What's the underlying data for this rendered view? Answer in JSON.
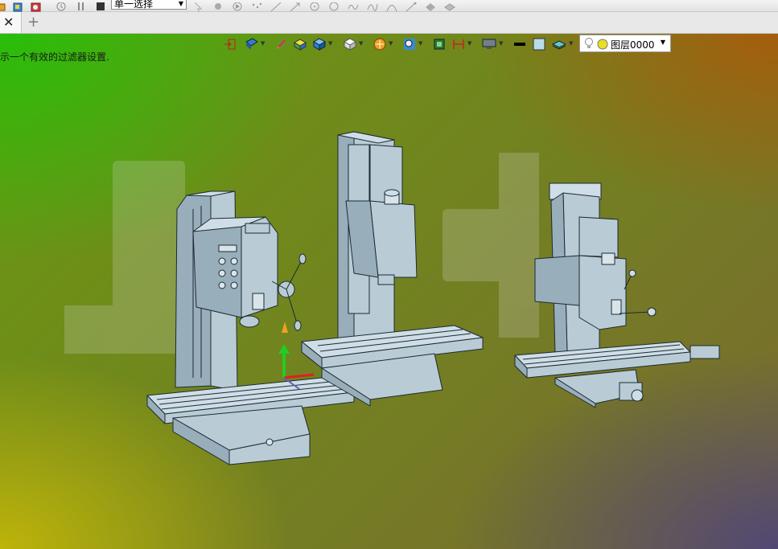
{
  "toolbar": {
    "selection_mode": "单一选择"
  },
  "tabs": {
    "close_symbol": "✕",
    "add_symbol": "+"
  },
  "viewport": {
    "message": "示一个有效的过滤器设置.",
    "layer_select": {
      "value": "图层0000"
    }
  },
  "icons": {
    "top_toolbar": [
      "part-icon",
      "assembly-icon",
      "drawing-icon",
      "history-icon",
      "pause-icon",
      "stop-icon",
      "arrow-select-icon",
      "gear-select-icon",
      "play-icon",
      "points-icon",
      "line-icon",
      "arrow-line-icon",
      "circle-icon",
      "rotate-icon",
      "spline-icon",
      "curve-icon",
      "sketch-icon",
      "vertex-icon",
      "feature-icon",
      "surface-icon"
    ],
    "view_toolbar": [
      "exit-icon",
      "render-mode-icon",
      "brush-icon",
      "box-solid-icon",
      "cube-icon",
      "view-cube-icon",
      "filter-icon",
      "zoom-icon",
      "frame-icon",
      "dimension-icon",
      "display-icon",
      "line-color-icon",
      "fill-color-icon",
      "layer-stack-icon",
      "bulb-icon",
      "layer-color-icon"
    ]
  },
  "colors": {
    "machine_fill": "#b9ccd6",
    "machine_dark": "#98aebb",
    "machine_stroke": "#1d2a33",
    "axis_green": "#22cc22",
    "axis_red": "#e02020",
    "axis_orange": "#f0a020",
    "layer_dot": "#e8e020"
  }
}
